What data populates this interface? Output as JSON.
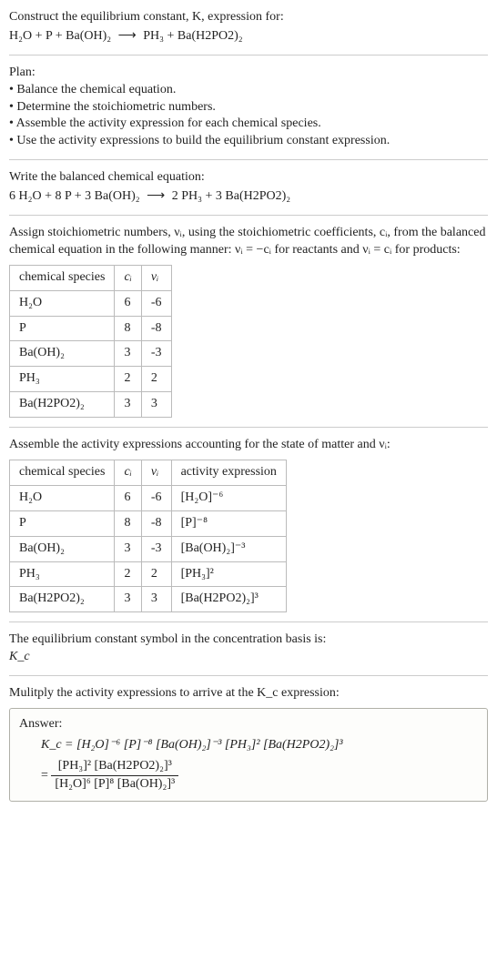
{
  "intro": {
    "line1": "Construct the equilibrium constant, K, expression for:",
    "eq_lhs": "H₂O + P + Ba(OH)₂",
    "eq_arrow": "⟶",
    "eq_rhs": "PH₃ + Ba(H2PO2)₂"
  },
  "plan": {
    "heading": "Plan:",
    "items": [
      "Balance the chemical equation.",
      "Determine the stoichiometric numbers.",
      "Assemble the activity expression for each chemical species.",
      "Use the activity expressions to build the equilibrium constant expression."
    ]
  },
  "balanced": {
    "heading": "Write the balanced chemical equation:",
    "eq_lhs": "6 H₂O + 8 P + 3 Ba(OH)₂",
    "eq_arrow": "⟶",
    "eq_rhs": "2 PH₃ + 3 Ba(H2PO2)₂"
  },
  "stoich": {
    "heading_a": "Assign stoichiometric numbers, νᵢ, using the stoichiometric coefficients, cᵢ, from the balanced chemical equation in the following manner: νᵢ = −cᵢ for reactants and νᵢ = cᵢ for products:",
    "headers": {
      "species": "chemical species",
      "c": "cᵢ",
      "v": "νᵢ"
    },
    "rows": [
      {
        "species": "H₂O",
        "c": "6",
        "v": "-6"
      },
      {
        "species": "P",
        "c": "8",
        "v": "-8"
      },
      {
        "species": "Ba(OH)₂",
        "c": "3",
        "v": "-3"
      },
      {
        "species": "PH₃",
        "c": "2",
        "v": "2"
      },
      {
        "species": "Ba(H2PO2)₂",
        "c": "3",
        "v": "3"
      }
    ]
  },
  "activity": {
    "heading": "Assemble the activity expressions accounting for the state of matter and νᵢ:",
    "headers": {
      "species": "chemical species",
      "c": "cᵢ",
      "v": "νᵢ",
      "act": "activity expression"
    },
    "rows": [
      {
        "species": "H₂O",
        "c": "6",
        "v": "-6",
        "act": "[H₂O]⁻⁶"
      },
      {
        "species": "P",
        "c": "8",
        "v": "-8",
        "act": "[P]⁻⁸"
      },
      {
        "species": "Ba(OH)₂",
        "c": "3",
        "v": "-3",
        "act": "[Ba(OH)₂]⁻³"
      },
      {
        "species": "PH₃",
        "c": "2",
        "v": "2",
        "act": "[PH₃]²"
      },
      {
        "species": "Ba(H2PO2)₂",
        "c": "3",
        "v": "3",
        "act": "[Ba(H2PO2)₂]³"
      }
    ]
  },
  "symbol": {
    "line1": "The equilibrium constant symbol in the concentration basis is:",
    "line2": "K_c"
  },
  "multiply": {
    "heading": "Mulitply the activity expressions to arrive at the K_c expression:"
  },
  "answer": {
    "label": "Answer:",
    "line1": "K_c = [H₂O]⁻⁶ [P]⁻⁸ [Ba(OH)₂]⁻³ [PH₃]² [Ba(H2PO2)₂]³",
    "frac_num": "[PH₃]² [Ba(H2PO2)₂]³",
    "frac_den": "[H₂O]⁶ [P]⁸ [Ba(OH)₂]³",
    "eq_prefix": "= "
  },
  "chart_data": {
    "type": "table",
    "tables": [
      {
        "title": "Stoichiometric numbers",
        "columns": [
          "chemical species",
          "c_i",
          "ν_i"
        ],
        "rows": [
          [
            "H2O",
            6,
            -6
          ],
          [
            "P",
            8,
            -8
          ],
          [
            "Ba(OH)2",
            3,
            -3
          ],
          [
            "PH3",
            2,
            2
          ],
          [
            "Ba(H2PO2)2",
            3,
            3
          ]
        ]
      },
      {
        "title": "Activity expressions",
        "columns": [
          "chemical species",
          "c_i",
          "ν_i",
          "activity expression"
        ],
        "rows": [
          [
            "H2O",
            6,
            -6,
            "[H2O]^-6"
          ],
          [
            "P",
            8,
            -8,
            "[P]^-8"
          ],
          [
            "Ba(OH)2",
            3,
            -3,
            "[Ba(OH)2]^-3"
          ],
          [
            "PH3",
            2,
            2,
            "[PH3]^2"
          ],
          [
            "Ba(H2PO2)2",
            3,
            3,
            "[Ba(H2PO2)2]^3"
          ]
        ]
      }
    ]
  }
}
